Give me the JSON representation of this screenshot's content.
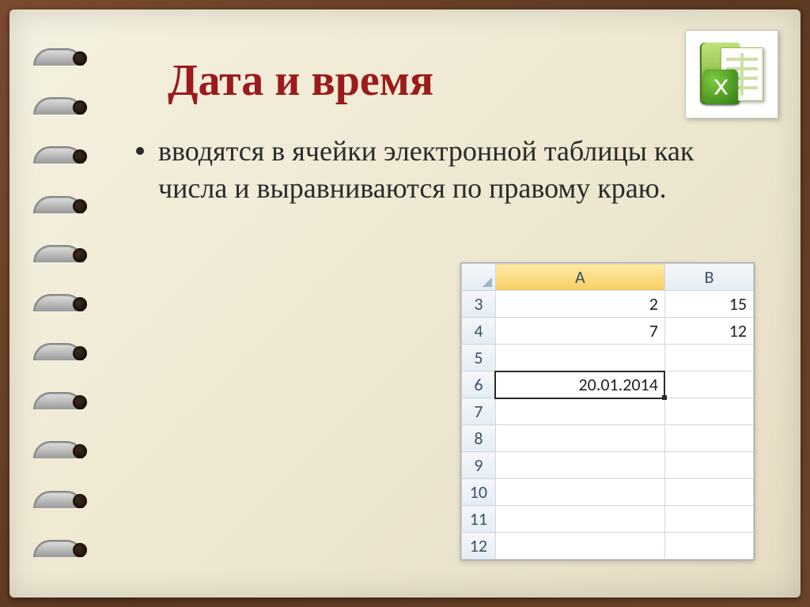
{
  "slide": {
    "title": "Дата и время",
    "bullet": "вводятся в ячейки электронной таблицы как числа и выравниваются по правому краю."
  },
  "icon": {
    "name": "excel-icon"
  },
  "sheet": {
    "columns": [
      "A",
      "B"
    ],
    "row_headers": [
      "3",
      "4",
      "5",
      "6",
      "7",
      "8",
      "9",
      "10",
      "11",
      "12"
    ],
    "cells": {
      "A3": "2",
      "B3": "15",
      "A4": "7",
      "B4": "12",
      "A6": "20.01.2014"
    },
    "active_cell": "A6"
  },
  "chart_data": {
    "type": "table",
    "title": "Дата и время",
    "columns": [
      "A",
      "B"
    ],
    "rows": [
      {
        "row": 3,
        "A": 2,
        "B": 15
      },
      {
        "row": 4,
        "A": 7,
        "B": 12
      },
      {
        "row": 5,
        "A": null,
        "B": null
      },
      {
        "row": 6,
        "A": "20.01.2014",
        "B": null
      },
      {
        "row": 7,
        "A": null,
        "B": null
      },
      {
        "row": 8,
        "A": null,
        "B": null
      },
      {
        "row": 9,
        "A": null,
        "B": null
      },
      {
        "row": 10,
        "A": null,
        "B": null
      },
      {
        "row": 11,
        "A": null,
        "B": null
      },
      {
        "row": 12,
        "A": null,
        "B": null
      }
    ]
  }
}
